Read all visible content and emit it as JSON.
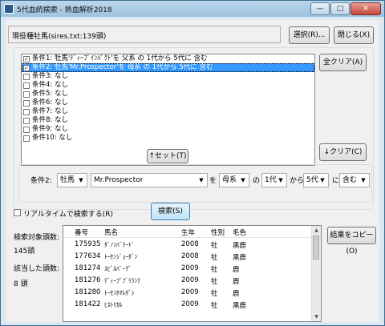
{
  "window": {
    "title": "5代血統検索 - 熱血解析2018",
    "controls": [
      "—",
      "□",
      "✕"
    ]
  },
  "toolbar": {
    "file_field": "現役種牡馬(sires.txt:139頭)",
    "select_button": "選択(R)...",
    "close_button": "閉じる(X)"
  },
  "conditions": [
    {
      "label": "条件1: 牡馬'ﾃﾞｨｰﾌﾟｲﾝﾊﾟｸﾄ'を 父系 の 1代から 5代に 含む",
      "checked": true,
      "selected": false
    },
    {
      "label": "条件2: 牡馬'Mr.Prospector'を 母系 の 1代から 5代に 含む",
      "checked": true,
      "selected": true
    },
    {
      "label": "条件3: なし",
      "checked": false,
      "selected": false
    },
    {
      "label": "条件4: なし",
      "checked": false,
      "selected": false
    },
    {
      "label": "条件5: なし",
      "checked": false,
      "selected": false
    },
    {
      "label": "条件6: なし",
      "checked": false,
      "selected": false
    },
    {
      "label": "条件7: なし",
      "checked": false,
      "selected": false
    },
    {
      "label": "条件8: なし",
      "checked": false,
      "selected": false
    },
    {
      "label": "条件9: なし",
      "checked": false,
      "selected": false
    },
    {
      "label": "条件10: なし",
      "checked": false,
      "selected": false
    }
  ],
  "buttons": {
    "all_clear": "全クリア(A)",
    "set": "↑セット(T)",
    "clear": "↓クリア(C)",
    "search": "検索(S)",
    "copy": "結果をコピー(O)"
  },
  "editor": {
    "label": "条件2:",
    "sex": "牡馬",
    "horse": "Mr.Prospector",
    "wo": "を",
    "line": "母系",
    "no": "の",
    "from_gen": "1代",
    "kara": "から",
    "to_gen": "5代",
    "ni": "に",
    "mode": "含む"
  },
  "realtime_label": "リアルタイムで検索する(R)",
  "stats": {
    "target_label": "検索対象頭数:",
    "target_value": "145頭",
    "match_label": "該当した頭数:",
    "match_value": "8 頭"
  },
  "results": {
    "columns": [
      "番号",
      "馬名",
      "生年",
      "性別",
      "毛色"
    ],
    "rows": [
      [
        "175935",
        "ﾀﾞﾉﾝﾊﾞﾗｰﾄﾞ",
        "2008",
        "牡",
        "黒鹿"
      ],
      [
        "177634",
        "ﾄｰｾﾝｼﾞｮｰﾀﾞﾝ",
        "2008",
        "牡",
        "黒鹿"
      ],
      [
        "181274",
        "ｽﾋﾟﾙﾊﾞｰｸﾞ",
        "2009",
        "牡",
        "鹿"
      ],
      [
        "181276",
        "ﾃﾞｨｰﾌﾟﾌﾞﾘﾗﾝﾃ",
        "2009",
        "牡",
        "鹿"
      ],
      [
        "181280",
        "ﾄｰｾﾝﾎﾏﾚﾎﾞｼ",
        "2009",
        "牡",
        "鹿"
      ],
      [
        "181422",
        "ﾋｽﾄﾘｶﾙ",
        "2009",
        "牡",
        "黒鹿"
      ]
    ]
  }
}
